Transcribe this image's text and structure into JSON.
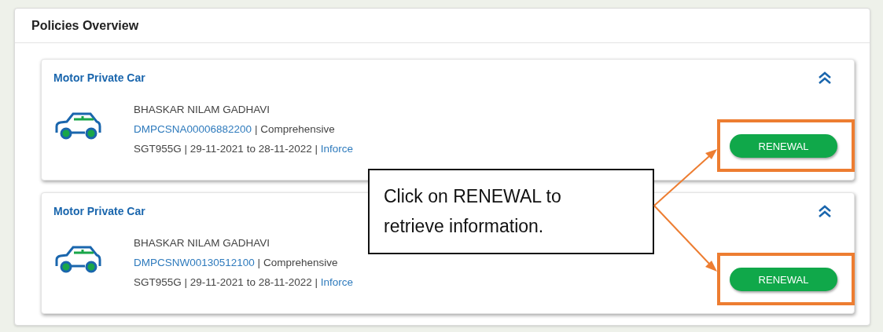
{
  "panel": {
    "title": "Policies Overview"
  },
  "policies": [
    {
      "category": "Motor Private Car",
      "holder": "BHASKAR NILAM GADHAVI",
      "policy_no": "DMPCSNA00006882200",
      "cover": "Comprehensive",
      "vehicle": "SGT955G",
      "period": "29-11-2021 to 28-11-2022",
      "status": "Inforce",
      "separator": "|",
      "button": "RENEWAL",
      "highlighted": true
    },
    {
      "category": "Motor Private Car",
      "holder": "BHASKAR NILAM GADHAVI",
      "policy_no": "DMPCSNW00130512100",
      "cover": "Comprehensive",
      "vehicle": "SGT955G",
      "period": "29-11-2021 to 28-11-2022",
      "status": "Inforce",
      "separator": "|",
      "button": "RENEWAL",
      "highlighted": true
    }
  ],
  "callout": {
    "text": "Click on RENEWAL to retrieve information."
  }
}
